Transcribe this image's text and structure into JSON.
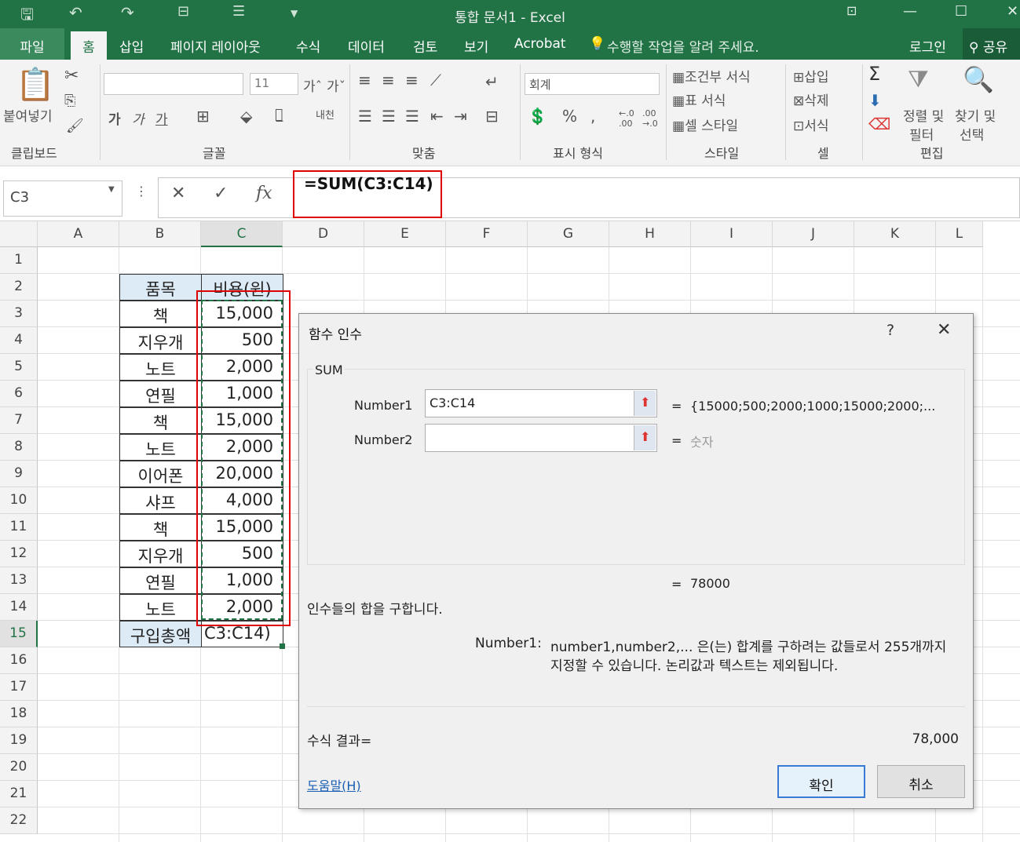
{
  "window": {
    "title": "통합 문서1 - Excel"
  },
  "tabs": {
    "file": "파일",
    "home": "홈",
    "insert": "삽입",
    "layout": "페이지 레이아웃",
    "formulas": "수식",
    "data": "데이터",
    "review": "검토",
    "view": "보기",
    "acrobat": "Acrobat",
    "tell_me": "수행할 작업을 알려 주세요.",
    "login": "로그인",
    "share": "공유"
  },
  "ribbon": {
    "clipboard": {
      "paste": "붙여넣기",
      "group": "클립보드"
    },
    "font": {
      "size": "11",
      "bold": "가",
      "italic": "가",
      "underline": "가",
      "group": "글꼴"
    },
    "align": {
      "group": "맞춤"
    },
    "number": {
      "format": "회계",
      "percent": "%",
      "group": "표시 형식"
    },
    "styles": {
      "conditional": "조건부 서식",
      "table": "표 서식",
      "cell": "셀 스타일",
      "group": "스타일"
    },
    "cells": {
      "insert": "삽입",
      "delete": "삭제",
      "format": "서식",
      "group": "셀"
    },
    "editing": {
      "sort": "정렬 및",
      "sort2": "필터",
      "find": "찾기 및",
      "find2": "선택",
      "group": "편집"
    }
  },
  "formula_bar": {
    "name_box": "C3",
    "formula": "=SUM(C3:C14)",
    "fx": "fx"
  },
  "columns": [
    "A",
    "B",
    "C",
    "D",
    "E",
    "F",
    "G",
    "H",
    "I",
    "J",
    "K",
    "L"
  ],
  "rows": [
    "1",
    "2",
    "3",
    "4",
    "5",
    "6",
    "7",
    "8",
    "9",
    "10",
    "11",
    "12",
    "13",
    "14",
    "15",
    "16",
    "17",
    "18",
    "19",
    "20",
    "21",
    "22"
  ],
  "table": {
    "header": {
      "item": "품목",
      "cost": "비용(원)"
    },
    "rows": [
      {
        "item": "책",
        "cost": "15,000"
      },
      {
        "item": "지우개",
        "cost": "500"
      },
      {
        "item": "노트",
        "cost": "2,000"
      },
      {
        "item": "연필",
        "cost": "1,000"
      },
      {
        "item": "책",
        "cost": "15,000"
      },
      {
        "item": "노트",
        "cost": "2,000"
      },
      {
        "item": "이어폰",
        "cost": "20,000"
      },
      {
        "item": "샤프",
        "cost": "4,000"
      },
      {
        "item": "책",
        "cost": "15,000"
      },
      {
        "item": "지우개",
        "cost": "500"
      },
      {
        "item": "연필",
        "cost": "1,000"
      },
      {
        "item": "노트",
        "cost": "2,000"
      }
    ],
    "total_label": "구입총액",
    "total_value": "C3:C14)"
  },
  "dialog": {
    "title": "함수 인수",
    "question": "?",
    "function": "SUM",
    "number1_label": "Number1",
    "number1_value": "C3:C14",
    "number1_result": "{15000;500;2000;1000;15000;2000;...",
    "number2_label": "Number2",
    "number2_result": "숫자",
    "eq": "=",
    "total": "78000",
    "description": "인수들의 합을 구합니다.",
    "arg_desc_label": "Number1:",
    "arg_desc_line1": "number1,number2,... 은(는) 합계를 구하려는 값들로서 255개까지",
    "arg_desc_line2": "지정할 수 있습니다. 논리값과 텍스트는 제외됩니다.",
    "result_label": "수식 결과=",
    "result_value": "78,000",
    "help": "도움말(H)",
    "ok": "확인",
    "cancel": "취소"
  }
}
